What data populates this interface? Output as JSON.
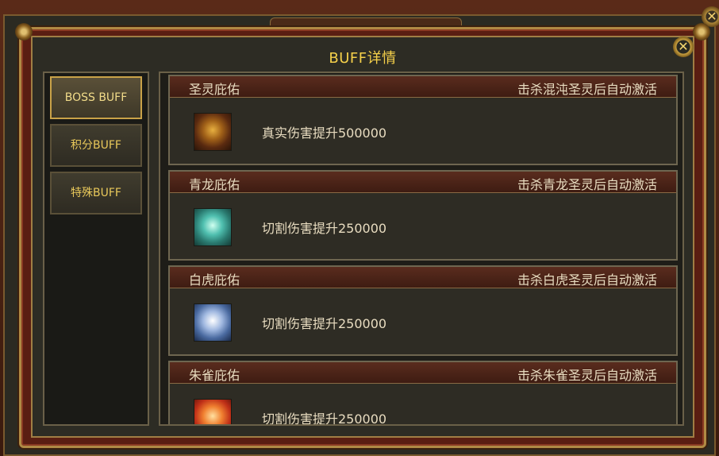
{
  "dialog": {
    "title": "BUFF详情",
    "close_label": "✕",
    "background_close_label": "✕"
  },
  "tabs": [
    {
      "label": "BOSS BUFF",
      "active": true
    },
    {
      "label": "积分BUFF",
      "active": false
    },
    {
      "label": "特殊BUFF",
      "active": false
    }
  ],
  "buffs": [
    {
      "name": "圣灵庇佑",
      "condition": "击杀混沌圣灵后自动激活",
      "description": "真实伤害提升500000",
      "icon": "golden-beast-icon"
    },
    {
      "name": "青龙庇佑",
      "condition": "击杀青龙圣灵后自动激活",
      "description": "切割伤害提升250000",
      "icon": "azure-dragon-icon"
    },
    {
      "name": "白虎庇佑",
      "condition": "击杀白虎圣灵后自动激活",
      "description": "切割伤害提升250000",
      "icon": "white-tiger-icon"
    },
    {
      "name": "朱雀庇佑",
      "condition": "击杀朱雀圣灵后自动激活",
      "description": "切割伤害提升250000",
      "icon": "vermilion-bird-icon"
    }
  ],
  "colors": {
    "title": "#f5d04a",
    "frame_gold": "#b08a44",
    "header_red": "#5a2c1e",
    "text": "#e8dcc0"
  }
}
